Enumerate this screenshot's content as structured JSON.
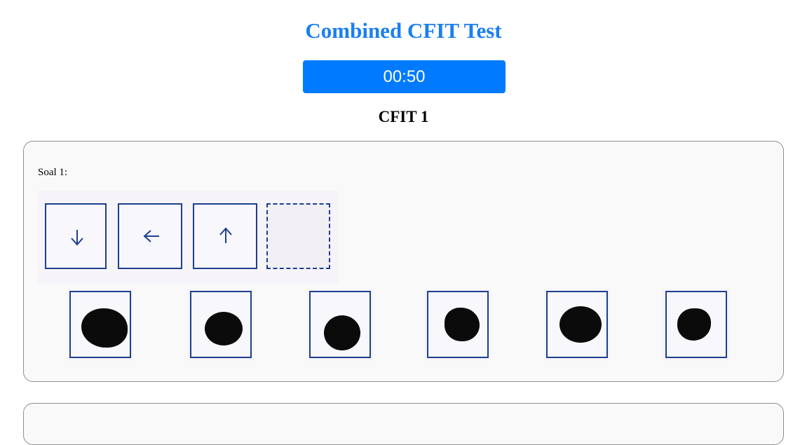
{
  "page": {
    "title": "Combined CFIT Test",
    "timer": "00:50",
    "section_title": "CFIT 1"
  },
  "question1": {
    "label": "Soal 1:",
    "stimulus_icons": [
      "arrow-down-icon",
      "arrow-left-icon",
      "arrow-up-icon",
      "empty-answer-slot"
    ],
    "option_count": 6
  },
  "colors": {
    "title": "#1a7ff0",
    "timer_bg": "#007bff",
    "frame_border": "#1c3f8f",
    "card_bg": "#f9f9f9"
  }
}
